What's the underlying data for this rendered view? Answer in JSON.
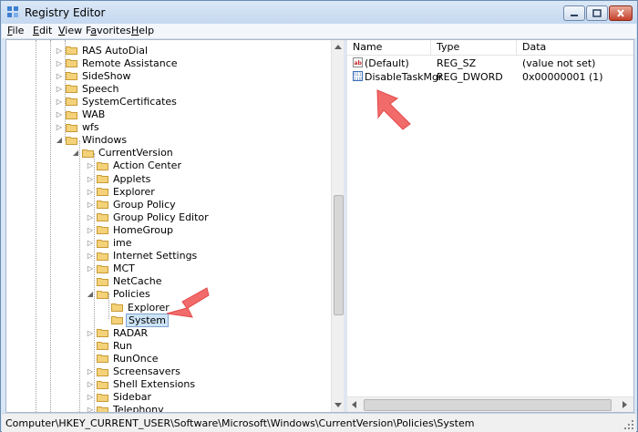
{
  "window": {
    "title": "Registry Editor",
    "controls": {
      "minimize_icon": "minimize-icon",
      "maximize_icon": "maximize-icon",
      "close_icon": "close-icon"
    }
  },
  "menu": [
    {
      "key": "F",
      "rest": "ile"
    },
    {
      "key": "E",
      "rest": "dit"
    },
    {
      "key": "V",
      "rest": "iew"
    },
    {
      "key": "",
      "pre": "F",
      "mid": "a",
      "rest": "vorites"
    },
    {
      "key": "H",
      "rest": "elp"
    }
  ],
  "tree": {
    "nodes": [
      {
        "label": "RAS AutoDial",
        "expander": "▷"
      },
      {
        "label": "Remote Assistance",
        "expander": "▷"
      },
      {
        "label": "SideShow",
        "expander": "▷"
      },
      {
        "label": "Speech",
        "expander": "▷"
      },
      {
        "label": "SystemCertificates",
        "expander": "▷"
      },
      {
        "label": "WAB",
        "expander": "▷"
      },
      {
        "label": "wfs",
        "expander": "▷"
      },
      {
        "label": "Windows",
        "expander": "◢"
      },
      {
        "label": "CurrentVersion",
        "expander": "◢"
      },
      {
        "label": "Action Center",
        "expander": "▷"
      },
      {
        "label": "Applets",
        "expander": "▷"
      },
      {
        "label": "Explorer",
        "expander": "▷"
      },
      {
        "label": "Group Policy",
        "expander": "▷"
      },
      {
        "label": "Group Policy Editor",
        "expander": "▷"
      },
      {
        "label": "HomeGroup",
        "expander": "▷"
      },
      {
        "label": "ime",
        "expander": "▷"
      },
      {
        "label": "Internet Settings",
        "expander": "▷"
      },
      {
        "label": "MCT",
        "expander": "▷"
      },
      {
        "label": "NetCache",
        "expander": ""
      },
      {
        "label": "Policies",
        "expander": "◢"
      },
      {
        "label": "Explorer",
        "expander": ""
      },
      {
        "label": "System",
        "expander": ""
      },
      {
        "label": "RADAR",
        "expander": "▷"
      },
      {
        "label": "Run",
        "expander": ""
      },
      {
        "label": "RunOnce",
        "expander": ""
      },
      {
        "label": "Screensavers",
        "expander": "▷"
      },
      {
        "label": "Shell Extensions",
        "expander": "▷"
      },
      {
        "label": "Sidebar",
        "expander": "▷"
      },
      {
        "label": "Telephony",
        "expander": "▷"
      }
    ]
  },
  "list": {
    "columns": [
      "Name",
      "Type",
      "Data"
    ],
    "rows": [
      {
        "name": "(Default)",
        "type": "REG_SZ",
        "data": "(value not set)",
        "icon": "string-value-icon"
      },
      {
        "name": "DisableTaskMgr",
        "type": "REG_DWORD",
        "data": "0x00000001 (1)",
        "icon": "dword-value-icon"
      }
    ]
  },
  "status": {
    "path": "Computer\\HKEY_CURRENT_USER\\Software\\Microsoft\\Windows\\CurrentVersion\\Policies\\System"
  },
  "colors": {
    "selection": "#cde4f7",
    "arrow": "#f26b6b",
    "folder": "#f4d27a"
  }
}
